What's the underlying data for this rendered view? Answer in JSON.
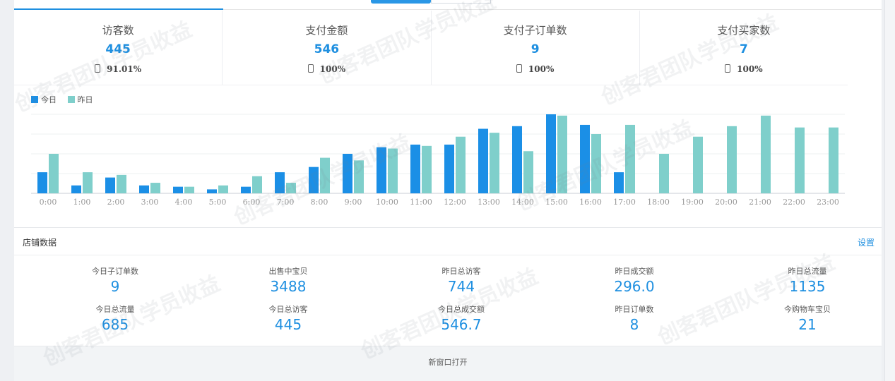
{
  "colors": {
    "accent": "#1e8fe0",
    "today": "#1b8fe6",
    "yesterday": "#7fcfcb"
  },
  "kpis": [
    {
      "label": "访客数",
      "value": "445",
      "sub": "91.01%",
      "icon": "phone-icon"
    },
    {
      "label": "支付金额",
      "value": "546",
      "sub": "100%",
      "icon": "phone-icon"
    },
    {
      "label": "支付子订单数",
      "value": "9",
      "sub": "100%",
      "icon": "phone-icon"
    },
    {
      "label": "支付买家数",
      "value": "7",
      "sub": "100%",
      "icon": "phone-icon"
    }
  ],
  "legend": {
    "today": "今日",
    "yesterday": "昨日"
  },
  "chart_data": {
    "type": "bar",
    "categories": [
      "0:00",
      "1:00",
      "2:00",
      "3:00",
      "4:00",
      "5:00",
      "6:00",
      "7:00",
      "8:00",
      "9:00",
      "10:00",
      "11:00",
      "12:00",
      "13:00",
      "14:00",
      "15:00",
      "16:00",
      "17:00",
      "18:00",
      "19:00",
      "20:00",
      "21:00",
      "22:00",
      "23:00"
    ],
    "series": [
      {
        "name": "今日",
        "values": [
          16,
          6,
          12,
          6,
          5,
          3,
          5,
          16,
          20,
          30,
          35,
          37,
          37,
          49,
          51,
          60,
          52,
          16,
          null,
          null,
          null,
          null,
          null,
          null
        ]
      },
      {
        "name": "昨日",
        "values": [
          30,
          16,
          14,
          8,
          5,
          6,
          13,
          8,
          27,
          25,
          34,
          36,
          43,
          46,
          32,
          59,
          45,
          52,
          30,
          43,
          51,
          59,
          50,
          50
        ]
      }
    ],
    "ylim": [
      0,
      60
    ],
    "grid": true,
    "legend_position": "top-left"
  },
  "store": {
    "title": "店铺数据",
    "settings": "设置",
    "stats": [
      {
        "label": "今日子订单数",
        "value": "9"
      },
      {
        "label": "出售中宝贝",
        "value": "3488"
      },
      {
        "label": "昨日总访客",
        "value": "744"
      },
      {
        "label": "昨日成交额",
        "value": "296.0"
      },
      {
        "label": "昨日总流量",
        "value": "1135"
      },
      {
        "label": "今日总流量",
        "value": "685"
      },
      {
        "label": "今日总访客",
        "value": "445"
      },
      {
        "label": "今日总成交额",
        "value": "546.7"
      },
      {
        "label": "昨日订单数",
        "value": "8"
      },
      {
        "label": "今购物车宝贝",
        "value": "21"
      }
    ]
  },
  "footer": {
    "open_new": "新窗口打开"
  },
  "watermark": "创客君团队学员收益"
}
